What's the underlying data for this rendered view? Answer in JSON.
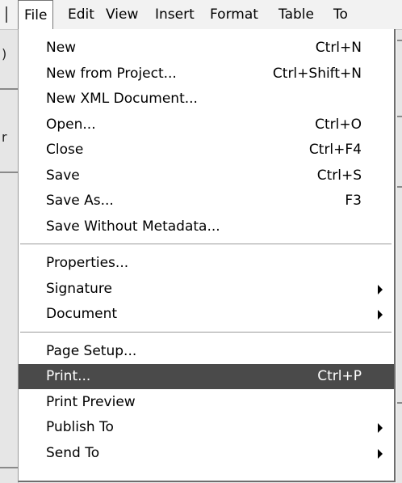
{
  "menubar": {
    "items": [
      "File",
      "Edit",
      "View",
      "Insert",
      "Format",
      "Table",
      "To"
    ],
    "active_index": 0
  },
  "background": {
    "left_fragments": [
      ")",
      "r"
    ]
  },
  "file_menu": {
    "groups": [
      [
        {
          "label": "New",
          "shortcut": "Ctrl+N",
          "submenu": false
        },
        {
          "label": "New from Project...",
          "shortcut": "Ctrl+Shift+N",
          "submenu": false
        },
        {
          "label": "New XML Document...",
          "shortcut": "",
          "submenu": false
        },
        {
          "label": "Open...",
          "shortcut": "Ctrl+O",
          "submenu": false
        },
        {
          "label": "Close",
          "shortcut": "Ctrl+F4",
          "submenu": false
        },
        {
          "label": "Save",
          "shortcut": "Ctrl+S",
          "submenu": false
        },
        {
          "label": "Save As...",
          "shortcut": "F3",
          "submenu": false
        },
        {
          "label": "Save Without Metadata...",
          "shortcut": "",
          "submenu": false
        }
      ],
      [
        {
          "label": "Properties...",
          "shortcut": "",
          "submenu": false
        },
        {
          "label": "Signature",
          "shortcut": "",
          "submenu": true
        },
        {
          "label": "Document",
          "shortcut": "",
          "submenu": true
        }
      ],
      [
        {
          "label": "Page Setup...",
          "shortcut": "",
          "submenu": false
        },
        {
          "label": "Print...",
          "shortcut": "Ctrl+P",
          "submenu": false,
          "highlighted": true
        },
        {
          "label": "Print Preview",
          "shortcut": "",
          "submenu": false
        },
        {
          "label": "Publish To",
          "shortcut": "",
          "submenu": true
        },
        {
          "label": "Send To",
          "shortcut": "",
          "submenu": true
        }
      ]
    ]
  },
  "colors": {
    "highlight_bg": "#4a4a4a",
    "highlight_fg": "#ffffff",
    "menu_bg": "#ffffff"
  }
}
